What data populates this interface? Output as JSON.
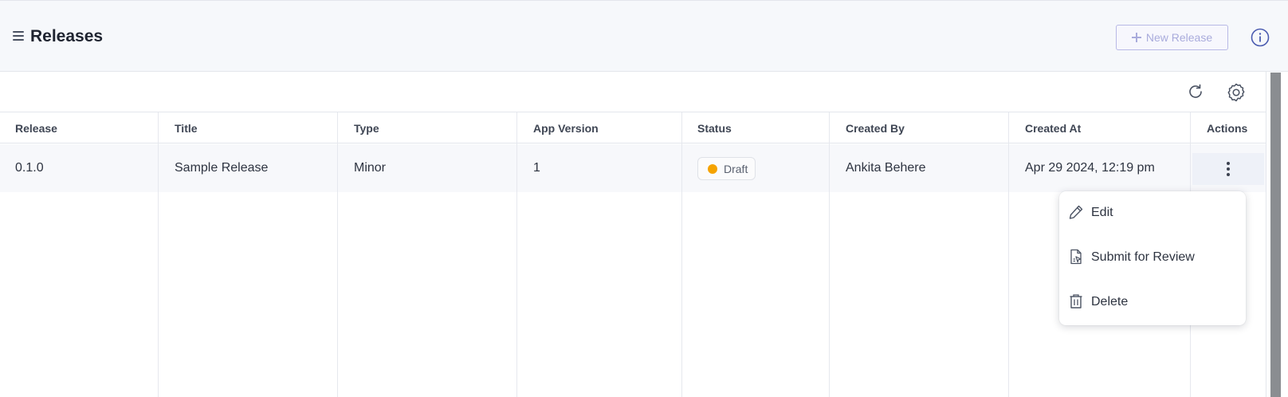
{
  "header": {
    "title": "Releases",
    "new_release_label": "New Release",
    "icons": {
      "menu": "hamburger-icon",
      "info": "info-icon"
    }
  },
  "toolbar": {
    "icons": {
      "refresh": "refresh-icon",
      "settings": "gear-icon"
    }
  },
  "table": {
    "columns": [
      "Release",
      "Title",
      "Type",
      "App Version",
      "Status",
      "Created By",
      "Created At",
      "Actions"
    ],
    "rows": [
      {
        "release": "0.1.0",
        "title": "Sample Release",
        "type": "Minor",
        "app_version": "1",
        "status": "Draft",
        "status_color": "#f5a300",
        "created_by": "Ankita Behere",
        "created_at": "Apr 29 2024, 12:19 pm"
      }
    ]
  },
  "actions_menu": {
    "items": [
      {
        "label": "Edit",
        "icon": "pencil-icon"
      },
      {
        "label": "Submit for Review",
        "icon": "document-submit-icon"
      },
      {
        "label": "Delete",
        "icon": "trash-icon"
      }
    ]
  },
  "colors": {
    "header_bg": "#f6f8fb",
    "accent_disabled": "#a9abdc",
    "draft": "#f5a300"
  }
}
